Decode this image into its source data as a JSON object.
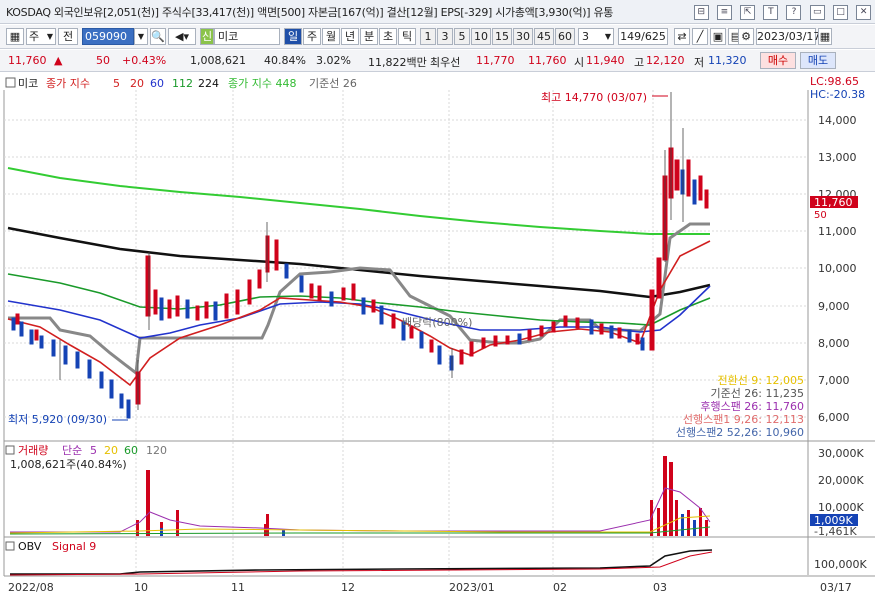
{
  "header": {
    "info_text": "KOSDAQ 외국인보유[2,051(천)] 주식수[33,417(천)] 액면[500] 자본금[167(억)] 결산[12월] EPS[-329] 시가총액[3,930(억)] 유통",
    "window_icons": [
      "⊟",
      "≡",
      "⇱",
      "T",
      "?",
      "▭",
      "□",
      "✕"
    ]
  },
  "toolbar": {
    "market_prefix": "주",
    "prev_label": "전",
    "code": "059090",
    "stock_name": "미코",
    "stock_badge": "신",
    "periods": [
      "일",
      "주",
      "월",
      "년",
      "분",
      "초",
      "틱"
    ],
    "numbers": [
      "1",
      "3",
      "5",
      "10",
      "15",
      "30",
      "45",
      "60"
    ],
    "count_value": "3",
    "page": "149/625",
    "date": "2023/03/17"
  },
  "quote": {
    "price": "11,760",
    "change": "50",
    "change_pct": "+0.43%",
    "volume": "1,008,621",
    "vol_ratio": "40.84%",
    "turnover": "3.02%",
    "amount": "11,822백만",
    "best_label": "최우선",
    "best_ask": "11,770",
    "best_bid": "11,760",
    "open_label": "시",
    "open": "11,940",
    "high_label": "고",
    "high": "12,120",
    "low_label": "저",
    "low": "11,320",
    "buy_label": "매수",
    "sell_label": "매도"
  },
  "chart": {
    "stock_label": "미코",
    "ma_label": "종가 지수",
    "ma_periods": [
      "5",
      "20",
      "60",
      "112",
      "224"
    ],
    "ma_long": "종가 지수 448",
    "base_line": "기준선 26",
    "lc": "LC:98.65",
    "hc": "HC:-20.38",
    "price_ticks": [
      "14,000",
      "13,000",
      "12,000",
      "11,000",
      "10,000",
      "9,000",
      "8,000",
      "7,000",
      "6,000"
    ],
    "last_price_tag": "11,760",
    "last_price_sub": "50",
    "high_note": "최고 14,770 (03/07)",
    "low_note": "최저 5,920 (09/30)",
    "mid_note": "배당락(800%)",
    "legend_lines": [
      {
        "text": "전환선 9: 12,005",
        "color": "#e6c000"
      },
      {
        "text": "기준선 26: 11,235",
        "color": "#555555"
      },
      {
        "text": "후행스팬 26: 11,760",
        "color": "#9b2fae"
      },
      {
        "text": "선행스팬1 9,26: 12,113",
        "color": "#e06c6c"
      },
      {
        "text": "선행스팬2 52,26: 10,960",
        "color": "#4466aa"
      }
    ],
    "volume_label": "거래량",
    "volume_ma_label": "단순",
    "volume_periods": [
      "5",
      "20",
      "60",
      "120"
    ],
    "volume_value": "1,008,621주(40.84%)",
    "volume_ticks": [
      "30,000K",
      "20,000K",
      "10,000K"
    ],
    "volume_tag": "1,009K",
    "volume_tag2": "-1,461K",
    "obv_label": "OBV",
    "obv_signal": "Signal 9",
    "obv_tick": "100,000K",
    "x_labels": [
      "2022/08",
      "10",
      "11",
      "12",
      "2023/01",
      "02",
      "03"
    ],
    "x_right": "03/17"
  },
  "colors": {
    "up": "#d0021b",
    "down": "#1543b5",
    "ma5": "#d11f1f",
    "ma20": "#d11f1f",
    "ma60": "#2233cc",
    "ma112": "#1a9a2a",
    "ma224": "#111111",
    "ma448": "#33cc33",
    "base": "#888888"
  }
}
